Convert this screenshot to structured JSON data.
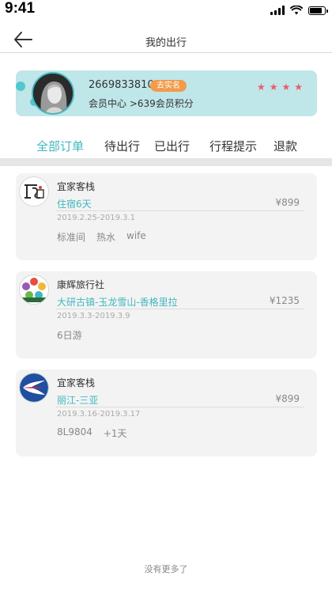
{
  "status_bar": {
    "time": "9:41"
  },
  "nav": {
    "title": "我的出行"
  },
  "profile": {
    "user_id": "2669833810",
    "verify_label": "去实名",
    "member_center": "会员中心",
    "points_text": ">639会员积分",
    "stars": [
      "★",
      "★",
      "★",
      "★"
    ]
  },
  "tabs": [
    {
      "label": "全部订单",
      "active": true
    },
    {
      "label": "待出行",
      "active": false
    },
    {
      "label": "已出行",
      "active": false
    },
    {
      "label": "行程提示",
      "active": false
    },
    {
      "label": "退款",
      "active": false
    }
  ],
  "orders": [
    {
      "shop": "宜家客栈",
      "route": "住宿6天",
      "price": "¥899",
      "dates": "2019.2.25-2019.3.1",
      "tags": [
        "标准间",
        "热水",
        "wife"
      ],
      "logo": "hotel-logo-icon"
    },
    {
      "shop": "康辉旅行社",
      "route": "大研古镇-玉龙雪山-香格里拉",
      "price": "¥1235",
      "dates": "2019.3.3-2019.3.9",
      "tags": [
        "6日游"
      ],
      "logo": "travel-agency-logo-icon"
    },
    {
      "shop": "宜家客栈",
      "route": "丽江-三亚",
      "price": "¥899",
      "dates": "2019.3.16-2019.3.17",
      "tags": [
        "8L9804",
        "+1天"
      ],
      "logo": "airline-logo-icon"
    }
  ],
  "footer": {
    "text": "没有更多了"
  },
  "colors": {
    "accent": "#3eb7bf",
    "card": "#bfe6e8",
    "badge": "#f29b4a",
    "star": "#ef5a68"
  }
}
